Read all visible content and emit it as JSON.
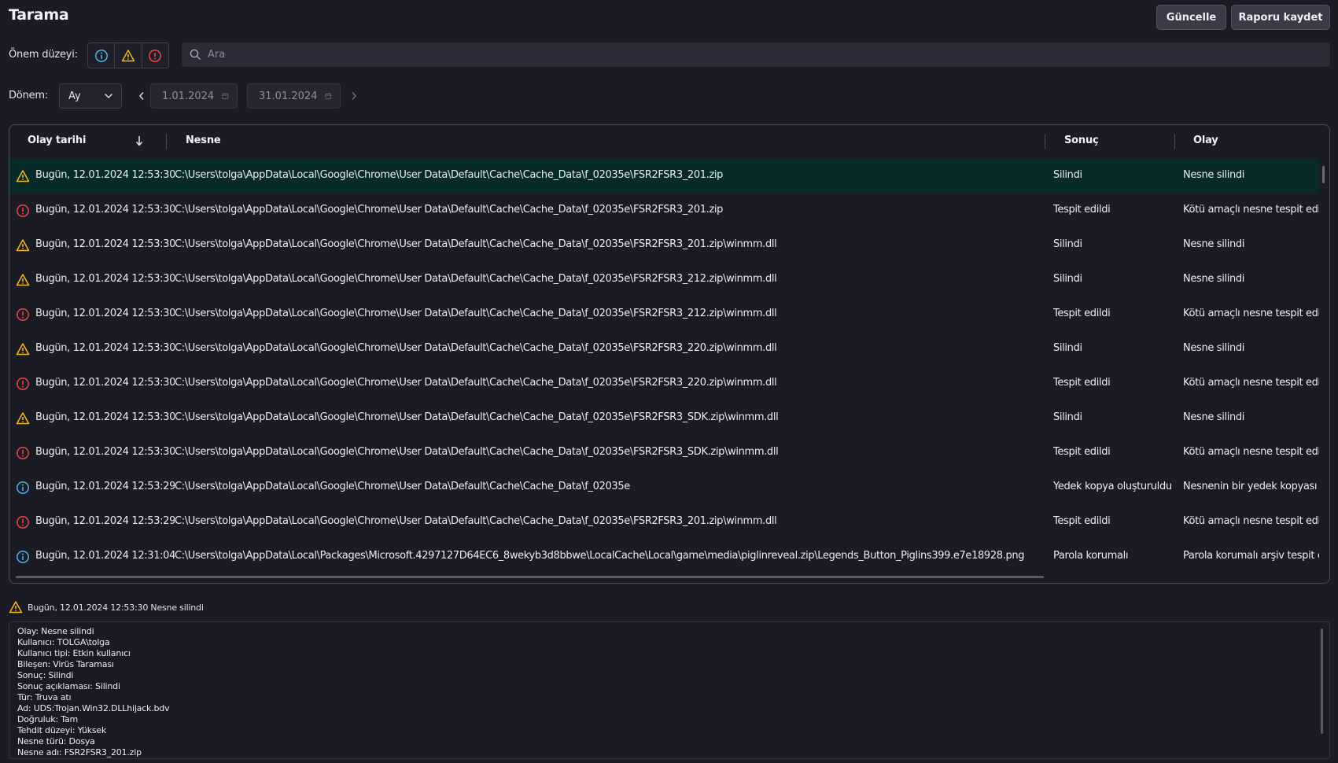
{
  "header": {
    "title": "Tarama",
    "refresh_label": "Güncelle",
    "save_report_label": "Raporu kaydet"
  },
  "filters": {
    "severity_label": "Önem düzeyi:",
    "severity_icons": [
      "info-icon",
      "warning-icon",
      "error-icon"
    ],
    "search_placeholder": "Ara",
    "period_label": "Dönem:",
    "period_value": "Ay",
    "date_from": "1.01.2024",
    "date_to": "31.01.2024"
  },
  "table": {
    "columns": [
      "Olay tarihi",
      "Nesne",
      "Sonuç",
      "Olay"
    ],
    "rows": [
      {
        "severity": "warning",
        "date": "Bugün, 12.01.2024 12:53:30",
        "object": "C:\\Users\\tolga\\AppData\\Local\\Google\\Chrome\\User Data\\Default\\Cache\\Cache_Data\\f_02035e\\FSR2FSR3_201.zip",
        "result": "Silindi",
        "event": "Nesne silindi"
      },
      {
        "severity": "error",
        "date": "Bugün, 12.01.2024 12:53:30",
        "object": "C:\\Users\\tolga\\AppData\\Local\\Google\\Chrome\\User Data\\Default\\Cache\\Cache_Data\\f_02035e\\FSR2FSR3_201.zip",
        "result": "Tespit edildi",
        "event": "Kötü amaçlı nesne tespit edi"
      },
      {
        "severity": "warning",
        "date": "Bugün, 12.01.2024 12:53:30",
        "object": "C:\\Users\\tolga\\AppData\\Local\\Google\\Chrome\\User Data\\Default\\Cache\\Cache_Data\\f_02035e\\FSR2FSR3_201.zip\\winmm.dll",
        "result": "Silindi",
        "event": "Nesne silindi"
      },
      {
        "severity": "warning",
        "date": "Bugün, 12.01.2024 12:53:30",
        "object": "C:\\Users\\tolga\\AppData\\Local\\Google\\Chrome\\User Data\\Default\\Cache\\Cache_Data\\f_02035e\\FSR2FSR3_212.zip\\winmm.dll",
        "result": "Silindi",
        "event": "Nesne silindi"
      },
      {
        "severity": "error",
        "date": "Bugün, 12.01.2024 12:53:30",
        "object": "C:\\Users\\tolga\\AppData\\Local\\Google\\Chrome\\User Data\\Default\\Cache\\Cache_Data\\f_02035e\\FSR2FSR3_212.zip\\winmm.dll",
        "result": "Tespit edildi",
        "event": "Kötü amaçlı nesne tespit edi"
      },
      {
        "severity": "warning",
        "date": "Bugün, 12.01.2024 12:53:30",
        "object": "C:\\Users\\tolga\\AppData\\Local\\Google\\Chrome\\User Data\\Default\\Cache\\Cache_Data\\f_02035e\\FSR2FSR3_220.zip\\winmm.dll",
        "result": "Silindi",
        "event": "Nesne silindi"
      },
      {
        "severity": "error",
        "date": "Bugün, 12.01.2024 12:53:30",
        "object": "C:\\Users\\tolga\\AppData\\Local\\Google\\Chrome\\User Data\\Default\\Cache\\Cache_Data\\f_02035e\\FSR2FSR3_220.zip\\winmm.dll",
        "result": "Tespit edildi",
        "event": "Kötü amaçlı nesne tespit edi"
      },
      {
        "severity": "warning",
        "date": "Bugün, 12.01.2024 12:53:30",
        "object": "C:\\Users\\tolga\\AppData\\Local\\Google\\Chrome\\User Data\\Default\\Cache\\Cache_Data\\f_02035e\\FSR2FSR3_SDK.zip\\winmm.dll",
        "result": "Silindi",
        "event": "Nesne silindi"
      },
      {
        "severity": "error",
        "date": "Bugün, 12.01.2024 12:53:30",
        "object": "C:\\Users\\tolga\\AppData\\Local\\Google\\Chrome\\User Data\\Default\\Cache\\Cache_Data\\f_02035e\\FSR2FSR3_SDK.zip\\winmm.dll",
        "result": "Tespit edildi",
        "event": "Kötü amaçlı nesne tespit edi"
      },
      {
        "severity": "info",
        "date": "Bugün, 12.01.2024 12:53:29",
        "object": "C:\\Users\\tolga\\AppData\\Local\\Google\\Chrome\\User Data\\Default\\Cache\\Cache_Data\\f_02035e",
        "result": "Yedek kopya oluşturuldu",
        "event": "Nesnenin bir yedek kopyası"
      },
      {
        "severity": "error",
        "date": "Bugün, 12.01.2024 12:53:29",
        "object": "C:\\Users\\tolga\\AppData\\Local\\Google\\Chrome\\User Data\\Default\\Cache\\Cache_Data\\f_02035e\\FSR2FSR3_201.zip\\winmm.dll",
        "result": "Tespit edildi",
        "event": "Kötü amaçlı nesne tespit edi"
      },
      {
        "severity": "info",
        "date": "Bugün, 12.01.2024 12:31:04",
        "object": "C:\\Users\\tolga\\AppData\\Local\\Packages\\Microsoft.4297127D64EC6_8wekyb3d8bbwe\\LocalCache\\Local\\game\\media\\piglinreveal.zip\\Legends_Button_Piglins399.e7e18928.png",
        "result": "Parola korumalı",
        "event": "Parola korumalı arşiv tespit e"
      }
    ]
  },
  "detail": {
    "header": "Bugün, 12.01.2024 12:53:30 Nesne silindi",
    "lines": [
      "Olay: Nesne silindi",
      "Kullanıcı: TOLGA\\tolga",
      "Kullanıcı tipi: Etkin kullanıcı",
      "Bileşen: Virüs Taraması",
      "Sonuç: Silindi",
      "Sonuç açıklaması: Silindi",
      "Tür: Truva atı",
      "Ad: UDS:Trojan.Win32.DLLhijack.bdv",
      "Doğruluk: Tam",
      "Tehdit düzeyi: Yüksek",
      "Nesne türü: Dosya",
      "Nesne adı: FSR2FSR3_201.zip"
    ]
  },
  "colors": {
    "background": "#1b1b25",
    "selected_row": "#082a29",
    "warning": "#f2b824",
    "error": "#e5484d",
    "info": "#4fb3e8"
  }
}
